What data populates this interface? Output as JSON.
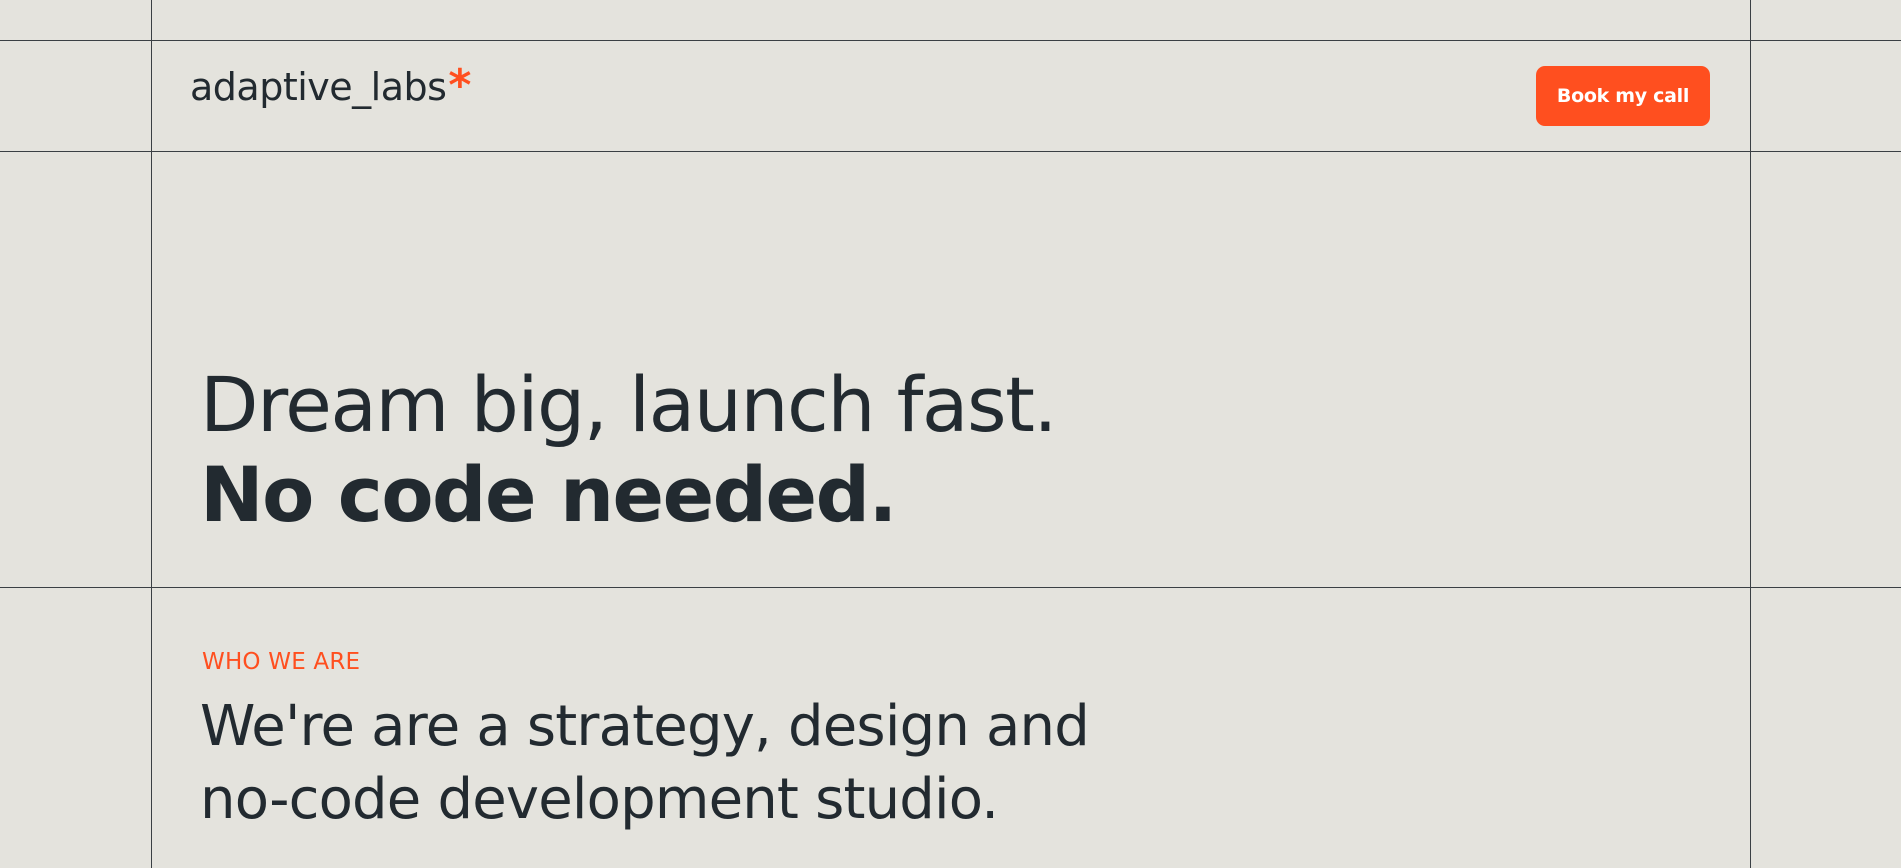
{
  "header": {
    "logo_text": "adaptive_labs",
    "logo_mark": "*",
    "cta_label": "Book my call"
  },
  "hero": {
    "headline_line1": "Dream big, launch fast.",
    "headline_line2": "No code needed."
  },
  "about": {
    "eyebrow": "WHO WE ARE",
    "description_line1": "We're are a strategy, design and",
    "description_line2": "no-code development studio."
  },
  "colors": {
    "background": "#e4e3dd",
    "accent": "#ff4f1f",
    "text": "#222a30",
    "grid_line": "#3a3f44"
  }
}
